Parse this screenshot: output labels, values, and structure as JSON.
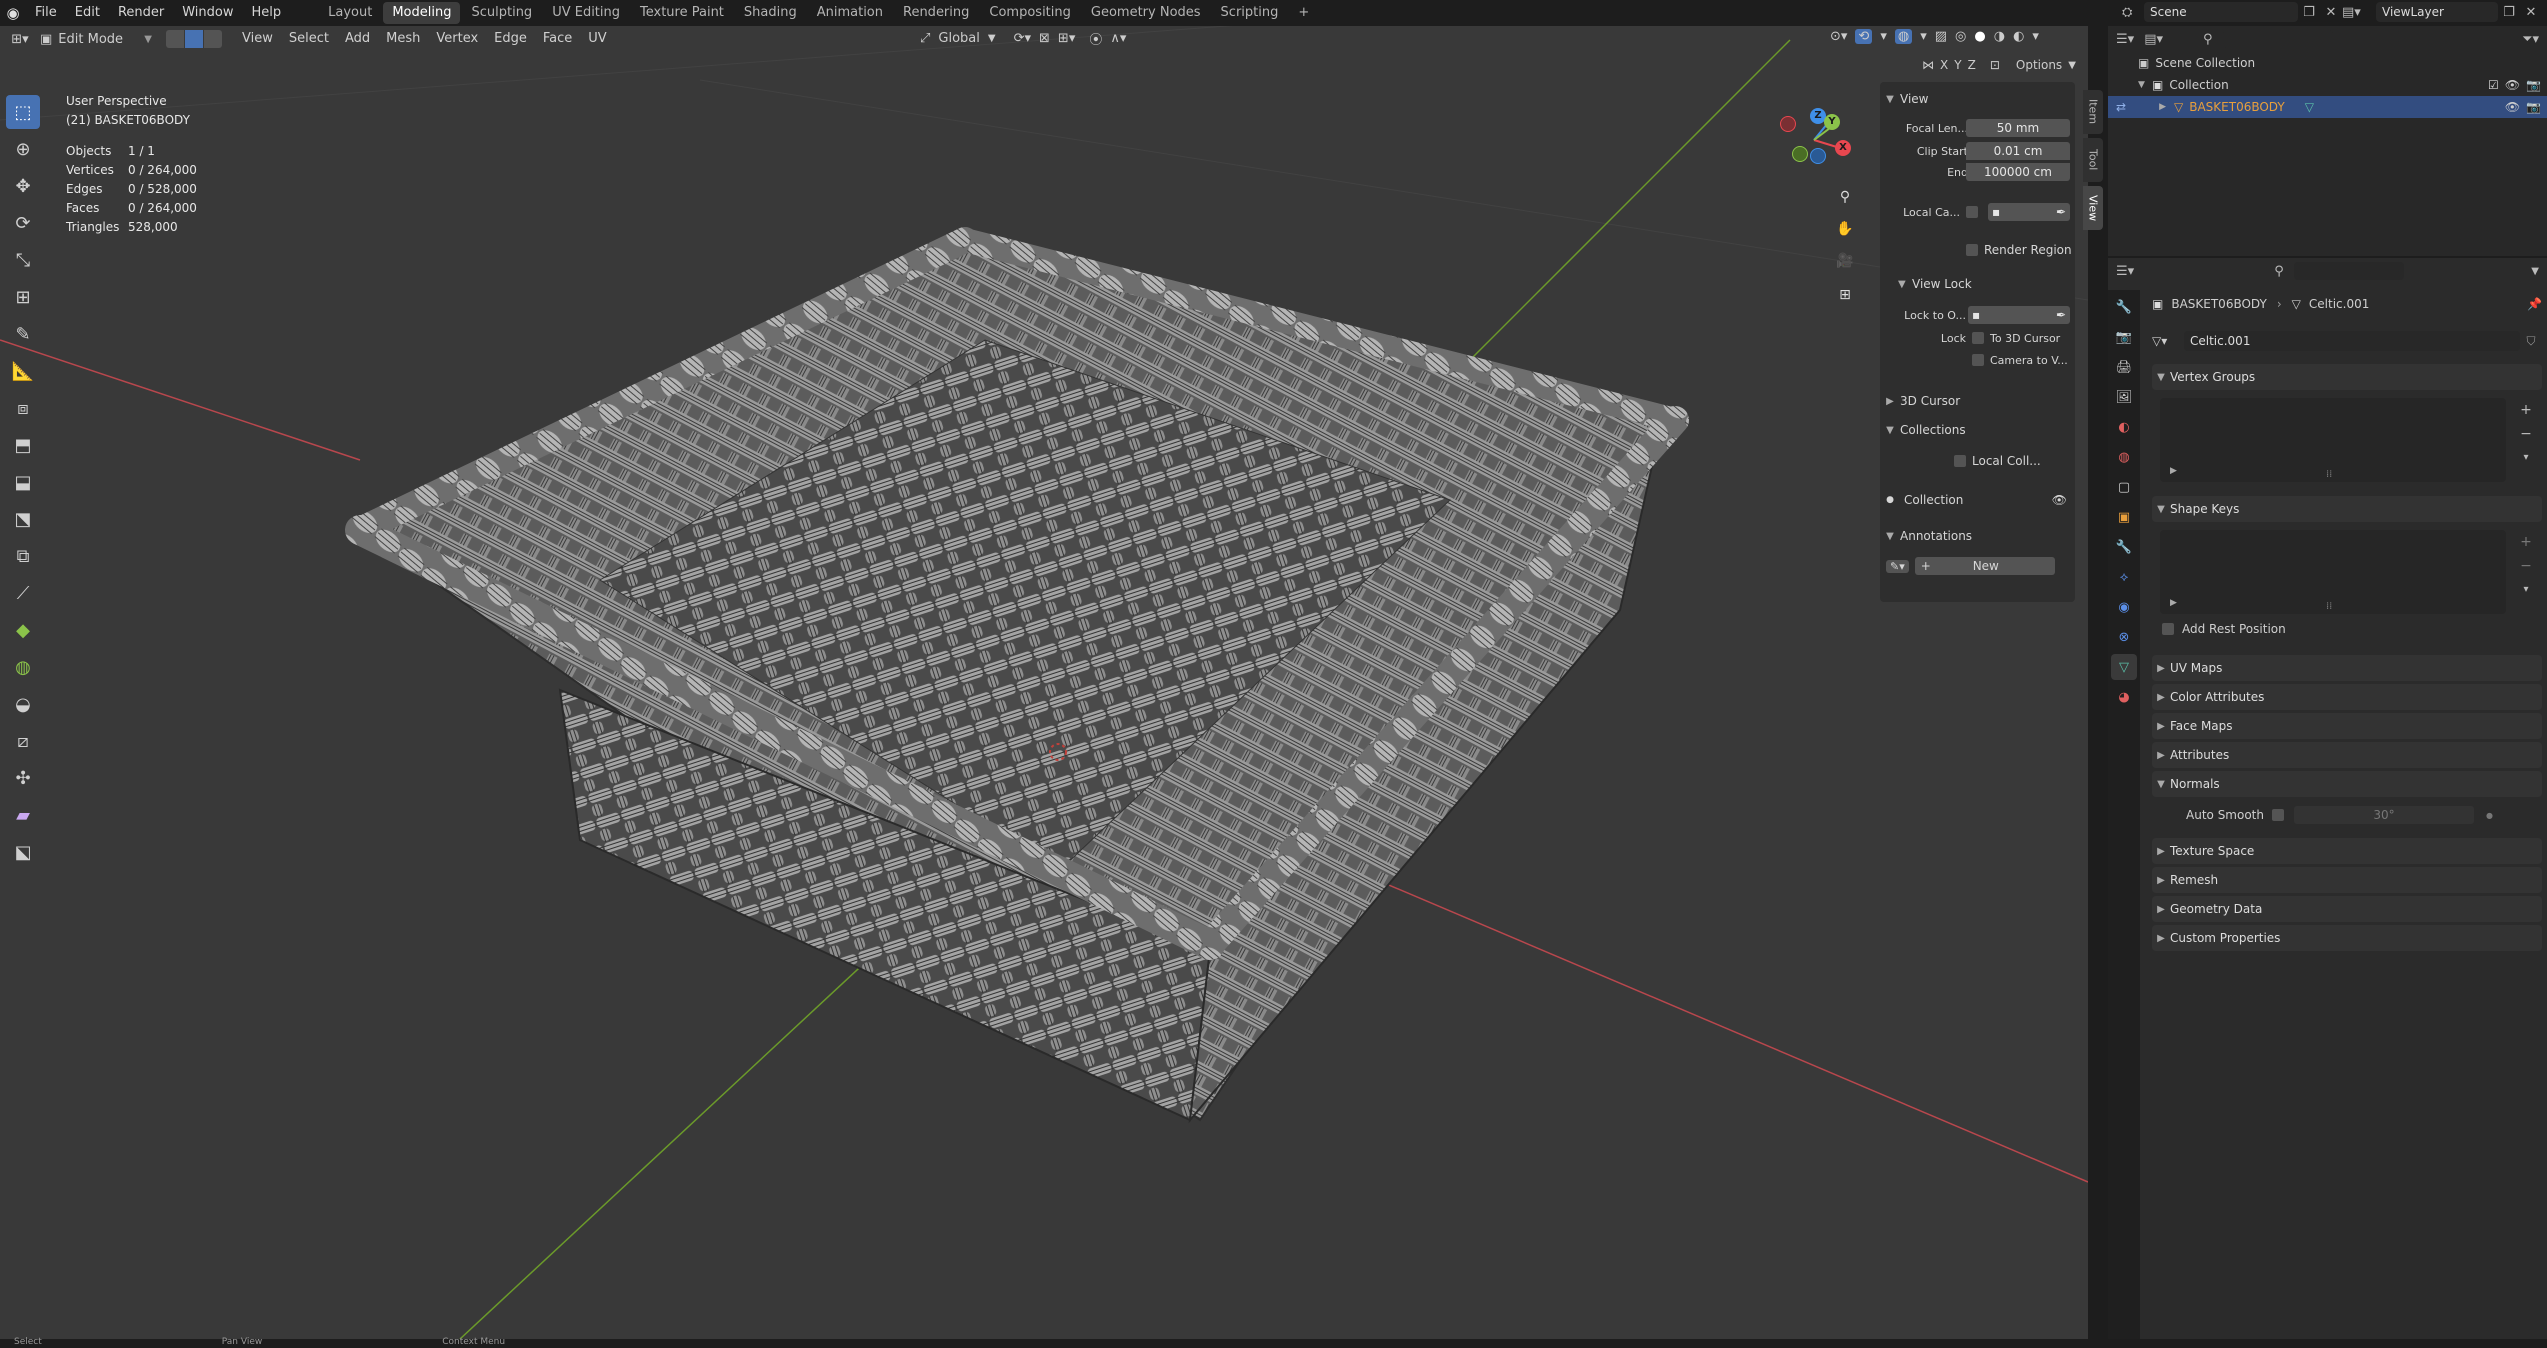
{
  "menubar": {
    "items": [
      "File",
      "Edit",
      "Render",
      "Window",
      "Help"
    ],
    "workspaces": [
      "Layout",
      "Modeling",
      "Sculpting",
      "UV Editing",
      "Texture Paint",
      "Shading",
      "Animation",
      "Rendering",
      "Compositing",
      "Geometry Nodes",
      "Scripting"
    ],
    "active_workspace": "Modeling",
    "add_tab": "+",
    "scene_label": "Scene",
    "viewlayer_label": "ViewLayer"
  },
  "viewport_header": {
    "mode": "Edit Mode",
    "menus": [
      "View",
      "Select",
      "Add",
      "Mesh",
      "Vertex",
      "Edge",
      "Face",
      "UV"
    ],
    "orientation": "Global",
    "axes": [
      "X",
      "Y",
      "Z"
    ],
    "options_label": "Options"
  },
  "viewport_overlay": {
    "perspective": "User Perspective",
    "object_label": "(21) BASKET06BODY",
    "stats": [
      {
        "key": "Objects",
        "value": "1 / 1"
      },
      {
        "key": "Vertices",
        "value": "0 / 264,000"
      },
      {
        "key": "Edges",
        "value": "0 / 528,000"
      },
      {
        "key": "Faces",
        "value": "0 / 264,000"
      },
      {
        "key": "Triangles",
        "value": "528,000"
      }
    ],
    "gizmo": {
      "x": "X",
      "y": "Y",
      "z": "Z"
    }
  },
  "npanel": {
    "tabs": [
      "Item",
      "Tool",
      "View"
    ],
    "active_tab": "View",
    "view_header": "View",
    "focal_length_label": "Focal Len...",
    "focal_length_value": "50 mm",
    "clip_start_label": "Clip Start",
    "clip_start_value": "0.01 cm",
    "clip_end_label": "End",
    "clip_end_value": "100000 cm",
    "local_camera_label": "Local Ca...",
    "render_region_label": "Render Region",
    "view_lock_header": "View Lock",
    "lock_to_object_label": "Lock to O...",
    "lock_label": "Lock",
    "to_3d_cursor_label": "To 3D Cursor",
    "camera_to_view_label": "Camera to V...",
    "cursor_header": "3D Cursor",
    "collections_header": "Collections",
    "local_collections_label": "Local Coll...",
    "collection_item": "Collection",
    "annotations_header": "Annotations",
    "new_label": "New"
  },
  "outliner": {
    "scene_collection": "Scene Collection",
    "collection": "Collection",
    "object": "BASKET06BODY"
  },
  "properties": {
    "breadcrumb_object": "BASKET06BODY",
    "breadcrumb_mesh": "Celtic.001",
    "mesh_name": "Celtic.001",
    "sections": {
      "vertex_groups": "Vertex Groups",
      "shape_keys": "Shape Keys",
      "add_rest_position": "Add Rest Position",
      "uv_maps": "UV Maps",
      "color_attributes": "Color Attributes",
      "face_maps": "Face Maps",
      "attributes": "Attributes",
      "normals": "Normals",
      "auto_smooth": "Auto Smooth",
      "auto_smooth_angle": "30°",
      "texture_space": "Texture Space",
      "remesh": "Remesh",
      "geometry_data": "Geometry Data",
      "custom_properties": "Custom Properties"
    }
  },
  "statusbar": {
    "items": [
      "Select",
      "Pan View",
      "Context Menu"
    ]
  },
  "colors": {
    "accent": "#4772b3",
    "viewport_bg": "#393939",
    "x_axis": "#b8474d",
    "y_axis": "#6b9a2a",
    "gizmo_x": "#e8474f",
    "gizmo_y": "#8bc34a",
    "gizmo_z": "#3f8fe8",
    "object_orange": "#e89f3c"
  }
}
